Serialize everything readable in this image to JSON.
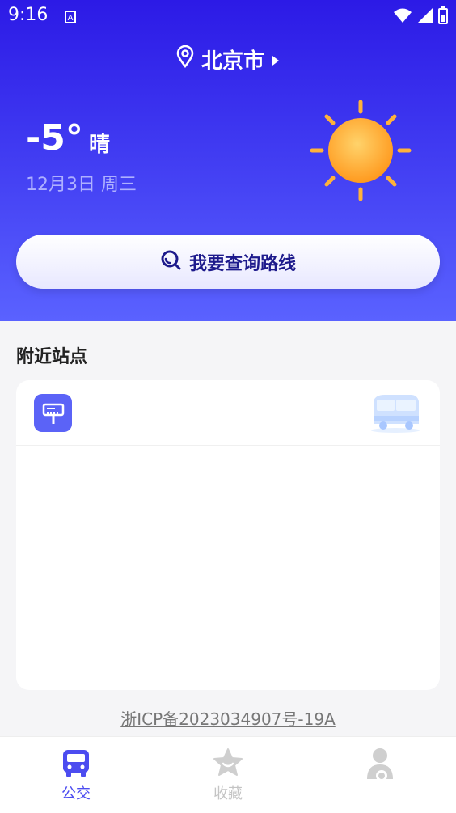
{
  "status_bar": {
    "time": "9:16"
  },
  "location": {
    "city": "北京市"
  },
  "weather": {
    "temperature": "-5°",
    "condition": "晴",
    "date": "12月3日 周三"
  },
  "search": {
    "label": "我要查询路线"
  },
  "nearby": {
    "title": "附近站点"
  },
  "footer": {
    "icp": "浙ICP备2023034907号-19A"
  },
  "tabs": [
    {
      "label": "公交",
      "icon": "bus-icon",
      "active": true
    },
    {
      "label": "收藏",
      "icon": "star-icon",
      "active": false
    },
    {
      "label": "",
      "icon": "user-icon",
      "active": false
    }
  ],
  "colors": {
    "primary": "#4c4cf0",
    "hero_top": "#2c1ae6",
    "hero_bottom": "#5a62ff"
  }
}
